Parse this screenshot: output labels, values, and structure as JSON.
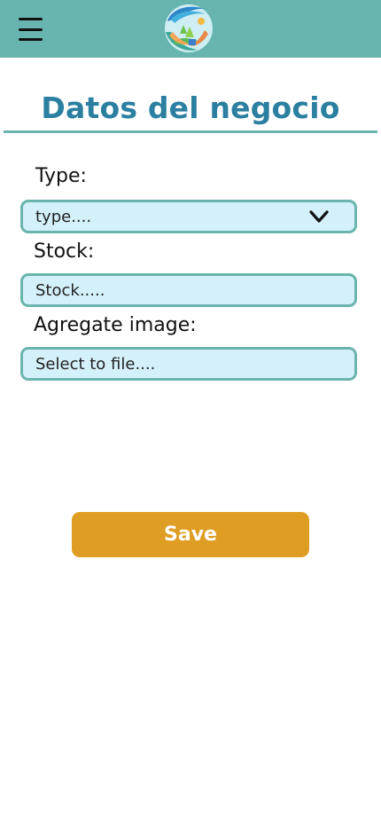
{
  "header": {
    "menu_icon": "hamburger-menu-icon",
    "logo_icon": "hands-globe-logo",
    "background_color": "#67b5ae"
  },
  "page": {
    "title": "Datos del negocio",
    "title_color": "#2b7fa0"
  },
  "form": {
    "type_label": "Type:",
    "type_placeholder": "type....",
    "type_icon": "chevron-down-icon",
    "stock_label": "Stock:",
    "stock_placeholder": "Stock.....",
    "image_label": "Agregate image:",
    "image_placeholder": "Select to file....",
    "field_background": "#d4f1fb",
    "field_border": "#6ab4ae"
  },
  "actions": {
    "save_label": "Save",
    "save_color": "#df9d23"
  }
}
